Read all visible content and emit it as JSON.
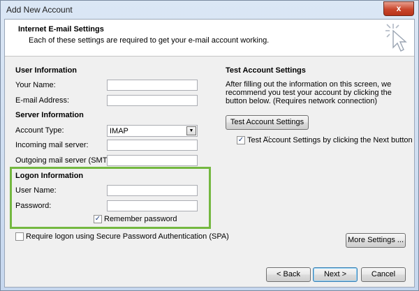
{
  "window": {
    "title": "Add New Account",
    "close_label": "x"
  },
  "header": {
    "title": "Internet E-mail Settings",
    "subtitle": "Each of these settings are required to get your e-mail account working."
  },
  "user_info": {
    "heading": "User Information",
    "name_label": "Your Name:",
    "email_label": "E-mail Address:"
  },
  "server_info": {
    "heading": "Server Information",
    "account_type_label": "Account Type:",
    "account_type_value": "IMAP",
    "incoming_label": "Incoming mail server:",
    "outgoing_label": "Outgoing mail server (SMTP):"
  },
  "logon_info": {
    "heading": "Logon Information",
    "username_label": "User Name:",
    "password_label": "Password:",
    "remember_label": "Remember password",
    "remember_checked": true,
    "spa_label": "Require logon using Secure Password Authentication (SPA)",
    "spa_checked": false
  },
  "test_settings": {
    "heading": "Test Account Settings",
    "description": "After filling out the information on this screen, we recommend you test your account by clicking the button below. (Requires network connection)",
    "test_button": "Test Account Settings ...",
    "next_check_label": "Test Account Settings by clicking the Next button",
    "next_check_checked": true
  },
  "buttons": {
    "more_settings": "More Settings ...",
    "back": "< Back",
    "next": "Next >",
    "cancel": "Cancel"
  },
  "colors": {
    "highlight_border": "#74b840",
    "title_bar": "#c6d7ee",
    "close_button": "#c9462c"
  }
}
